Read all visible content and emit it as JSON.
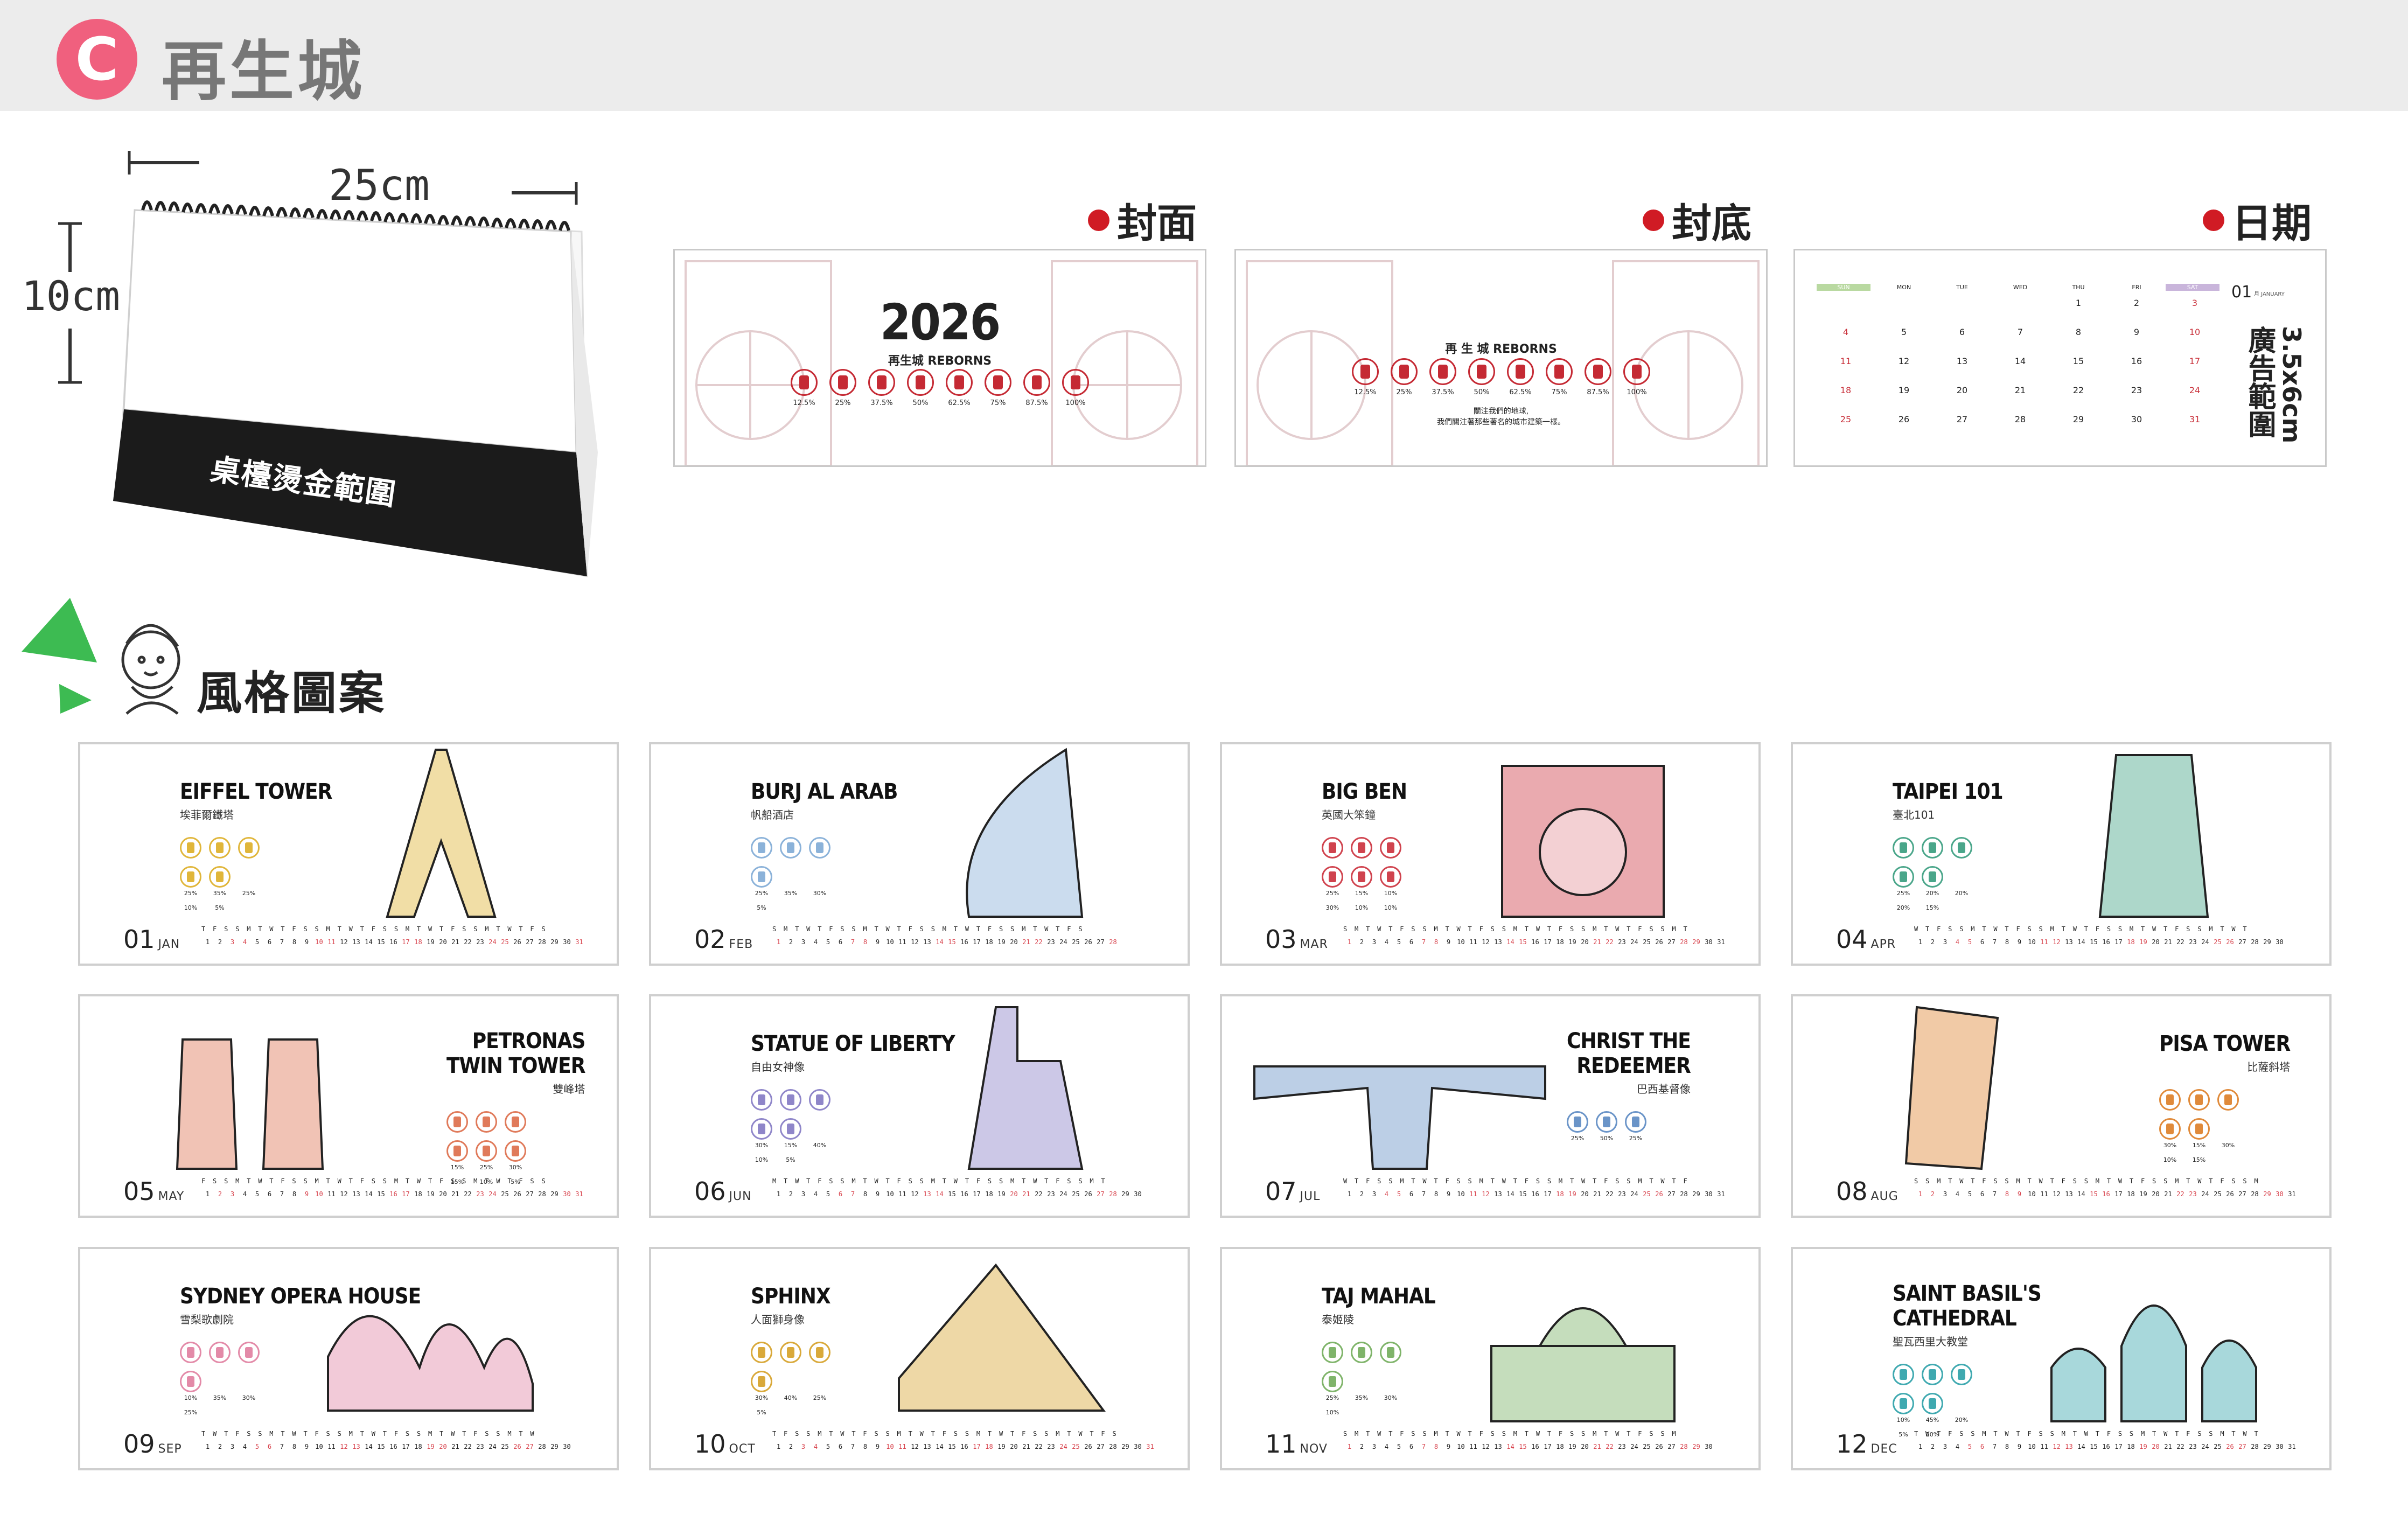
{
  "header": {
    "badge": "C",
    "title": "再生城"
  },
  "desk": {
    "width_label": "25cm",
    "height_label": "10cm",
    "foil_label": "桌檯燙金範圍"
  },
  "sections": {
    "cover": "封面",
    "back": "封底",
    "date": "日期"
  },
  "cover": {
    "year": "2026",
    "subtitle": "再生城 REBORNS",
    "percents": [
      "12.5%",
      "25%",
      "37.5%",
      "50%",
      "62.5%",
      "75%",
      "87.5%",
      "100%"
    ]
  },
  "back": {
    "subtitle": "再 生 城 REBORNS",
    "percents": [
      "12.5%",
      "25%",
      "37.5%",
      "50%",
      "62.5%",
      "75%",
      "87.5%",
      "100%"
    ],
    "text_line1": "關注我們的地球,",
    "text_line2": "我們關注著那些著名的城市建築一樣。"
  },
  "date_preview": {
    "weekdays": [
      "SUN",
      "MON",
      "TUE",
      "WED",
      "THU",
      "FRI",
      "SAT"
    ],
    "weeks": [
      [
        "",
        "",
        "",
        "",
        "1",
        "2",
        "3"
      ],
      [
        "4",
        "5",
        "6",
        "7",
        "8",
        "9",
        "10"
      ],
      [
        "11",
        "12",
        "13",
        "14",
        "15",
        "16",
        "17"
      ],
      [
        "18",
        "19",
        "20",
        "21",
        "22",
        "23",
        "24"
      ],
      [
        "25",
        "26",
        "27",
        "28",
        "29",
        "30",
        "31"
      ]
    ],
    "month_num": "01",
    "month_name": "月 JANUARY",
    "ad_label": "廣告範圍",
    "ad_size": "3.5x6cm"
  },
  "style_section": {
    "title": "風格圖案"
  },
  "months": [
    {
      "num": "01",
      "mon": "JAN",
      "name": "EIFFEL TOWER",
      "zh": "埃菲爾鐵塔",
      "pcts": [
        "25%",
        "35%",
        "25%",
        "10%",
        "5%"
      ],
      "accent": "#e0b63a",
      "art": "eiffel",
      "weekdays": "T F S S M T W T F S S M T W T F S S M T W T F S S M T W T F S",
      "days": 31,
      "red": [
        3,
        4,
        10,
        11,
        17,
        18,
        24,
        25,
        31
      ]
    },
    {
      "num": "02",
      "mon": "FEB",
      "name": "BURJ AL ARAB",
      "zh": "帆船酒店",
      "pcts": [
        "25%",
        "35%",
        "30%",
        "5%"
      ],
      "accent": "#8bb2d9",
      "art": "burj",
      "weekdays": "S M T W T F S S M T W T F S S M T W T F S S M T W T F S",
      "days": 28,
      "red": [
        1,
        7,
        8,
        14,
        15,
        21,
        22,
        28
      ]
    },
    {
      "num": "03",
      "mon": "MAR",
      "name": "BIG BEN",
      "zh": "英國大笨鐘",
      "pcts": [
        "25%",
        "15%",
        "10%",
        "30%",
        "10%",
        "10%"
      ],
      "accent": "#d0434e",
      "art": "bigben",
      "weekdays": "S M T W T F S S M T W T F S S M T W T F S S M T W T F S S M T",
      "days": 31,
      "red": [
        1,
        7,
        8,
        14,
        15,
        21,
        22,
        28,
        29
      ]
    },
    {
      "num": "04",
      "mon": "APR",
      "name": "TAIPEI 101",
      "zh": "臺北101",
      "pcts": [
        "25%",
        "20%",
        "20%",
        "20%",
        "15%"
      ],
      "accent": "#4aa68a",
      "art": "taipei",
      "weekdays": "W T F S S M T W T F S S M T W T F S S M T W T F S S M T W T",
      "days": 30,
      "red": [
        4,
        5,
        11,
        12,
        18,
        19,
        25,
        26
      ]
    },
    {
      "num": "05",
      "mon": "MAY",
      "name": "PETRONAS\nTWIN TOWER",
      "zh": "雙峰塔",
      "pcts": [
        "15%",
        "25%",
        "30%",
        "15%",
        "10%",
        "5%"
      ],
      "accent": "#e07a5a",
      "art": "petronas",
      "weekdays": "F S S M T W T F S S M T W T F S S M T W T F S S M T W T F S S",
      "days": 31,
      "red": [
        2,
        3,
        9,
        10,
        16,
        17,
        23,
        24,
        30,
        31
      ]
    },
    {
      "num": "06",
      "mon": "JUN",
      "name": "STATUE OF LIBERTY",
      "zh": "自由女神像",
      "pcts": [
        "30%",
        "15%",
        "40%",
        "10%",
        "5%"
      ],
      "accent": "#8f86c9",
      "art": "liberty",
      "weekdays": "M T W T F S S M T W T F S S M T W T F S S M T W T F S S M T",
      "days": 30,
      "red": [
        6,
        7,
        13,
        14,
        20,
        21,
        27,
        28
      ]
    },
    {
      "num": "07",
      "mon": "JUL",
      "name": "CHRIST THE\nREDEEMER",
      "zh": "巴西基督像",
      "pcts": [
        "25%",
        "50%",
        "25%"
      ],
      "accent": "#6a94c8",
      "art": "christ",
      "weekdays": "W T F S S M T W T F S S M T W T F S S M T W T F S S M T W T F",
      "days": 31,
      "red": [
        4,
        5,
        11,
        12,
        18,
        19,
        25,
        26
      ]
    },
    {
      "num": "08",
      "mon": "AUG",
      "name": "PISA TOWER",
      "zh": "比薩斜塔",
      "pcts": [
        "30%",
        "15%",
        "30%",
        "10%",
        "15%"
      ],
      "accent": "#e08a3a",
      "art": "pisa",
      "weekdays": "S S M T W T F S S M T W T F S S M T W T F S S M T W T F S S M",
      "days": 31,
      "red": [
        1,
        2,
        8,
        9,
        15,
        16,
        22,
        23,
        29,
        30
      ]
    },
    {
      "num": "09",
      "mon": "SEP",
      "name": "SYDNEY OPERA HOUSE",
      "zh": "雪梨歌劇院",
      "pcts": [
        "10%",
        "35%",
        "30%",
        "25%"
      ],
      "accent": "#e38aa8",
      "art": "opera",
      "weekdays": "T W T F S S M T W T F S S M T W T F S S M T W T F S S M T W",
      "days": 30,
      "red": [
        5,
        6,
        12,
        13,
        19,
        20,
        26,
        27
      ]
    },
    {
      "num": "10",
      "mon": "OCT",
      "name": "SPHINX",
      "zh": "人面獅身像",
      "pcts": [
        "30%",
        "40%",
        "25%",
        "5%"
      ],
      "accent": "#d9a93a",
      "art": "sphinx",
      "weekdays": "T F S S M T W T F S S M T W T F S S M T W T F S S M T W T F S",
      "days": 31,
      "red": [
        3,
        4,
        10,
        11,
        17,
        18,
        24,
        25,
        31
      ]
    },
    {
      "num": "11",
      "mon": "NOV",
      "name": "TAJ MAHAL",
      "zh": "泰姬陵",
      "pcts": [
        "25%",
        "35%",
        "30%",
        "10%"
      ],
      "accent": "#7fb46a",
      "art": "taj",
      "weekdays": "S M T W T F S S M T W T F S S M T W T F S S M T W T F S S M",
      "days": 30,
      "red": [
        1,
        7,
        8,
        14,
        15,
        21,
        22,
        28,
        29
      ]
    },
    {
      "num": "12",
      "mon": "DEC",
      "name": "SAINT BASIL'S\nCATHEDRAL",
      "zh": "聖瓦西里大教堂",
      "pcts": [
        "10%",
        "45%",
        "20%",
        "5%",
        "20%"
      ],
      "accent": "#3fa9b0",
      "art": "basil",
      "weekdays": "T W T F S S M T W T F S S M T W T F S S M T W T F S S M T W T",
      "days": 31,
      "red": [
        5,
        6,
        12,
        13,
        19,
        20,
        26,
        27
      ]
    }
  ]
}
